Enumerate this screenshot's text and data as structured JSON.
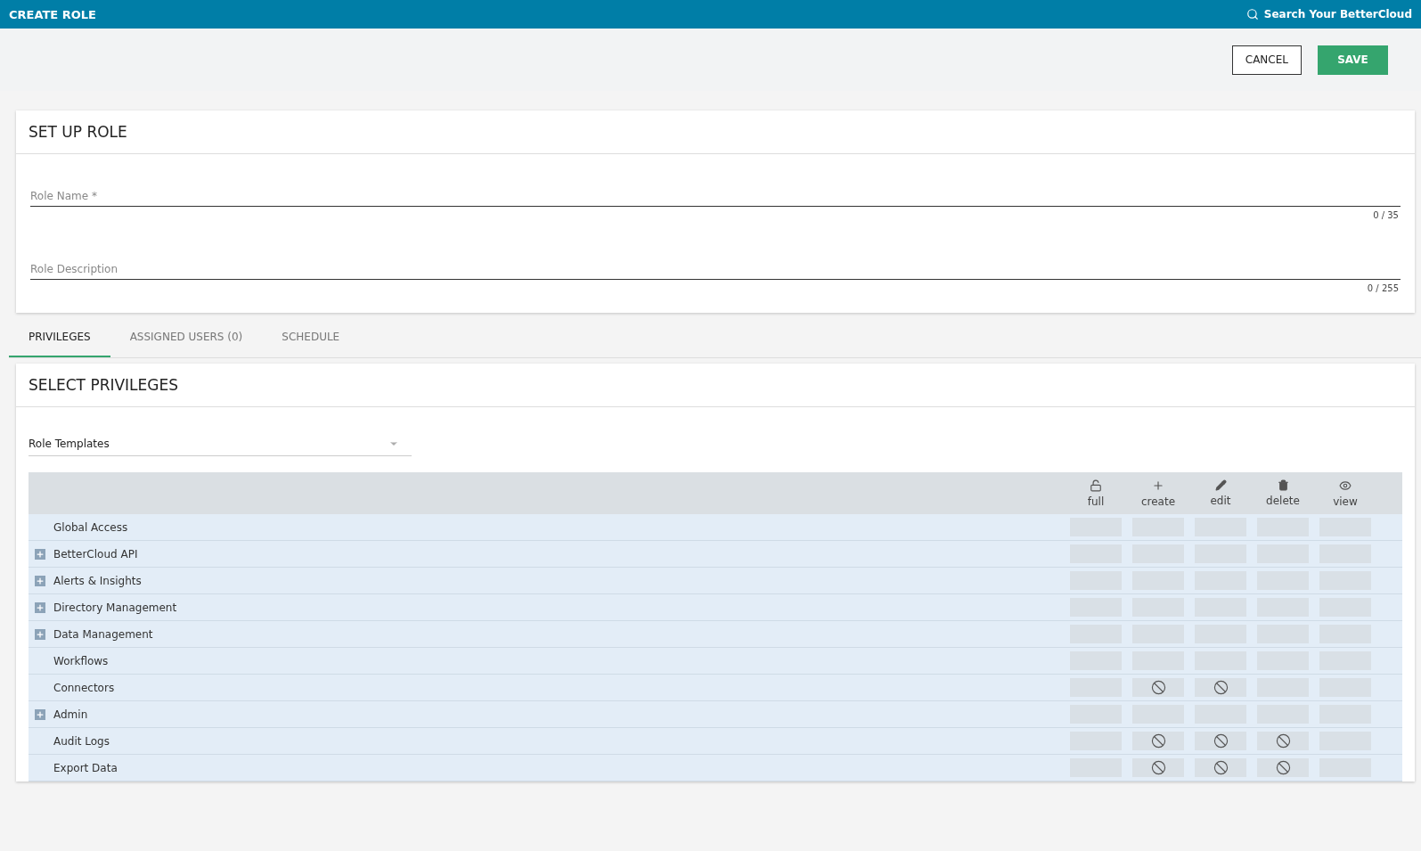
{
  "header": {
    "title": "CREATE ROLE",
    "search_label": "Search Your BetterCloud"
  },
  "actions": [
    {
      "label": "CANCEL",
      "kind": "outline"
    },
    {
      "label": "SAVE",
      "kind": "primary"
    }
  ],
  "setup": {
    "title": "SET UP ROLE",
    "fields": [
      {
        "placeholder": "Role Name *",
        "counter": "0 / 35"
      },
      {
        "placeholder": "Role Description",
        "counter": "0 / 255"
      }
    ]
  },
  "tabs": [
    {
      "label": "PRIVILEGES",
      "selected": true
    },
    {
      "label": "ASSIGNED USERS (0)",
      "selected": false
    },
    {
      "label": "SCHEDULE",
      "selected": false
    }
  ],
  "privileges": {
    "title": "SELECT PRIVILEGES",
    "template_select": {
      "value": "Role Templates"
    },
    "columns": [
      {
        "label": "full",
        "kind": "lock"
      },
      {
        "label": "create",
        "kind": "plus"
      },
      {
        "label": "edit",
        "kind": "pencil"
      },
      {
        "label": "delete",
        "kind": "trash"
      },
      {
        "label": "view",
        "kind": "eye"
      }
    ],
    "rows": [
      {
        "name": "Global Access",
        "kind": "item",
        "blocked": [
          false,
          false,
          false,
          false,
          false
        ]
      },
      {
        "name": "BetterCloud API",
        "kind": "group",
        "blocked": [
          false,
          false,
          false,
          false,
          false
        ]
      },
      {
        "name": "Alerts & Insights",
        "kind": "group",
        "blocked": [
          false,
          false,
          false,
          false,
          false
        ]
      },
      {
        "name": "Directory Management",
        "kind": "group",
        "blocked": [
          false,
          false,
          false,
          false,
          false
        ]
      },
      {
        "name": "Data Management",
        "kind": "group",
        "blocked": [
          false,
          false,
          false,
          false,
          false
        ]
      },
      {
        "name": "Workflows",
        "kind": "item",
        "blocked": [
          false,
          false,
          false,
          false,
          false
        ]
      },
      {
        "name": "Connectors",
        "kind": "item",
        "blocked": [
          false,
          true,
          true,
          false,
          false
        ]
      },
      {
        "name": "Admin",
        "kind": "group",
        "blocked": [
          false,
          false,
          false,
          false,
          false
        ]
      },
      {
        "name": "Audit Logs",
        "kind": "item",
        "blocked": [
          false,
          true,
          true,
          true,
          false
        ]
      },
      {
        "name": "Export Data",
        "kind": "item",
        "blocked": [
          false,
          true,
          true,
          true,
          false
        ]
      }
    ]
  }
}
